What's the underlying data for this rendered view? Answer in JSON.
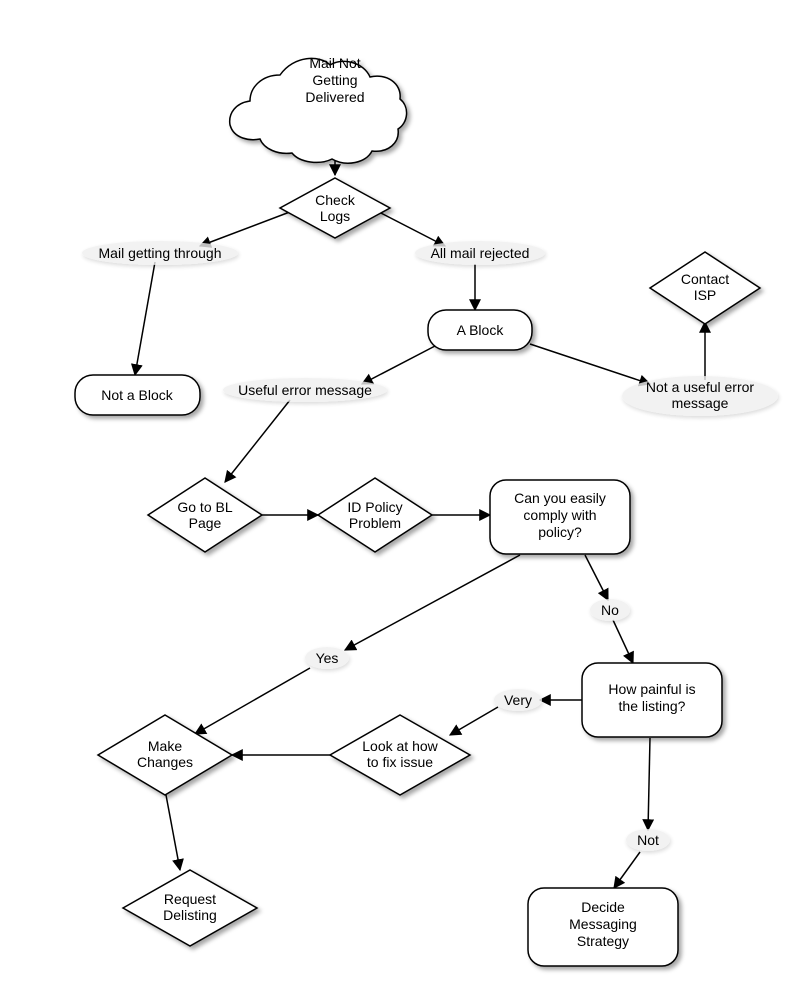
{
  "nodes": {
    "start": "Mail Not\nGetting\nDelivered",
    "check_logs": "Check\nLogs",
    "not_a_block": "Not a Block",
    "a_block": "A Block",
    "contact_isp": "Contact\nISP",
    "go_to_bl": "Go to BL\nPage",
    "id_policy": "ID Policy\nProblem",
    "comply": "Can you easily\ncomply with\npolicy?",
    "make_changes": "Make\nChanges",
    "look_fix": "Look at how\nto fix issue",
    "painful": "How painful is\nthe listing?",
    "request_delist": "Request\nDelisting",
    "decide_strategy": "Decide\nMessaging\nStrategy"
  },
  "edges": {
    "mail_through": "Mail getting through",
    "all_rejected": "All mail rejected",
    "useful_err": "Useful error message",
    "not_useful_err": "Not a useful error\nmessage",
    "yes": "Yes",
    "no": "No",
    "very": "Very",
    "not": "Not"
  }
}
